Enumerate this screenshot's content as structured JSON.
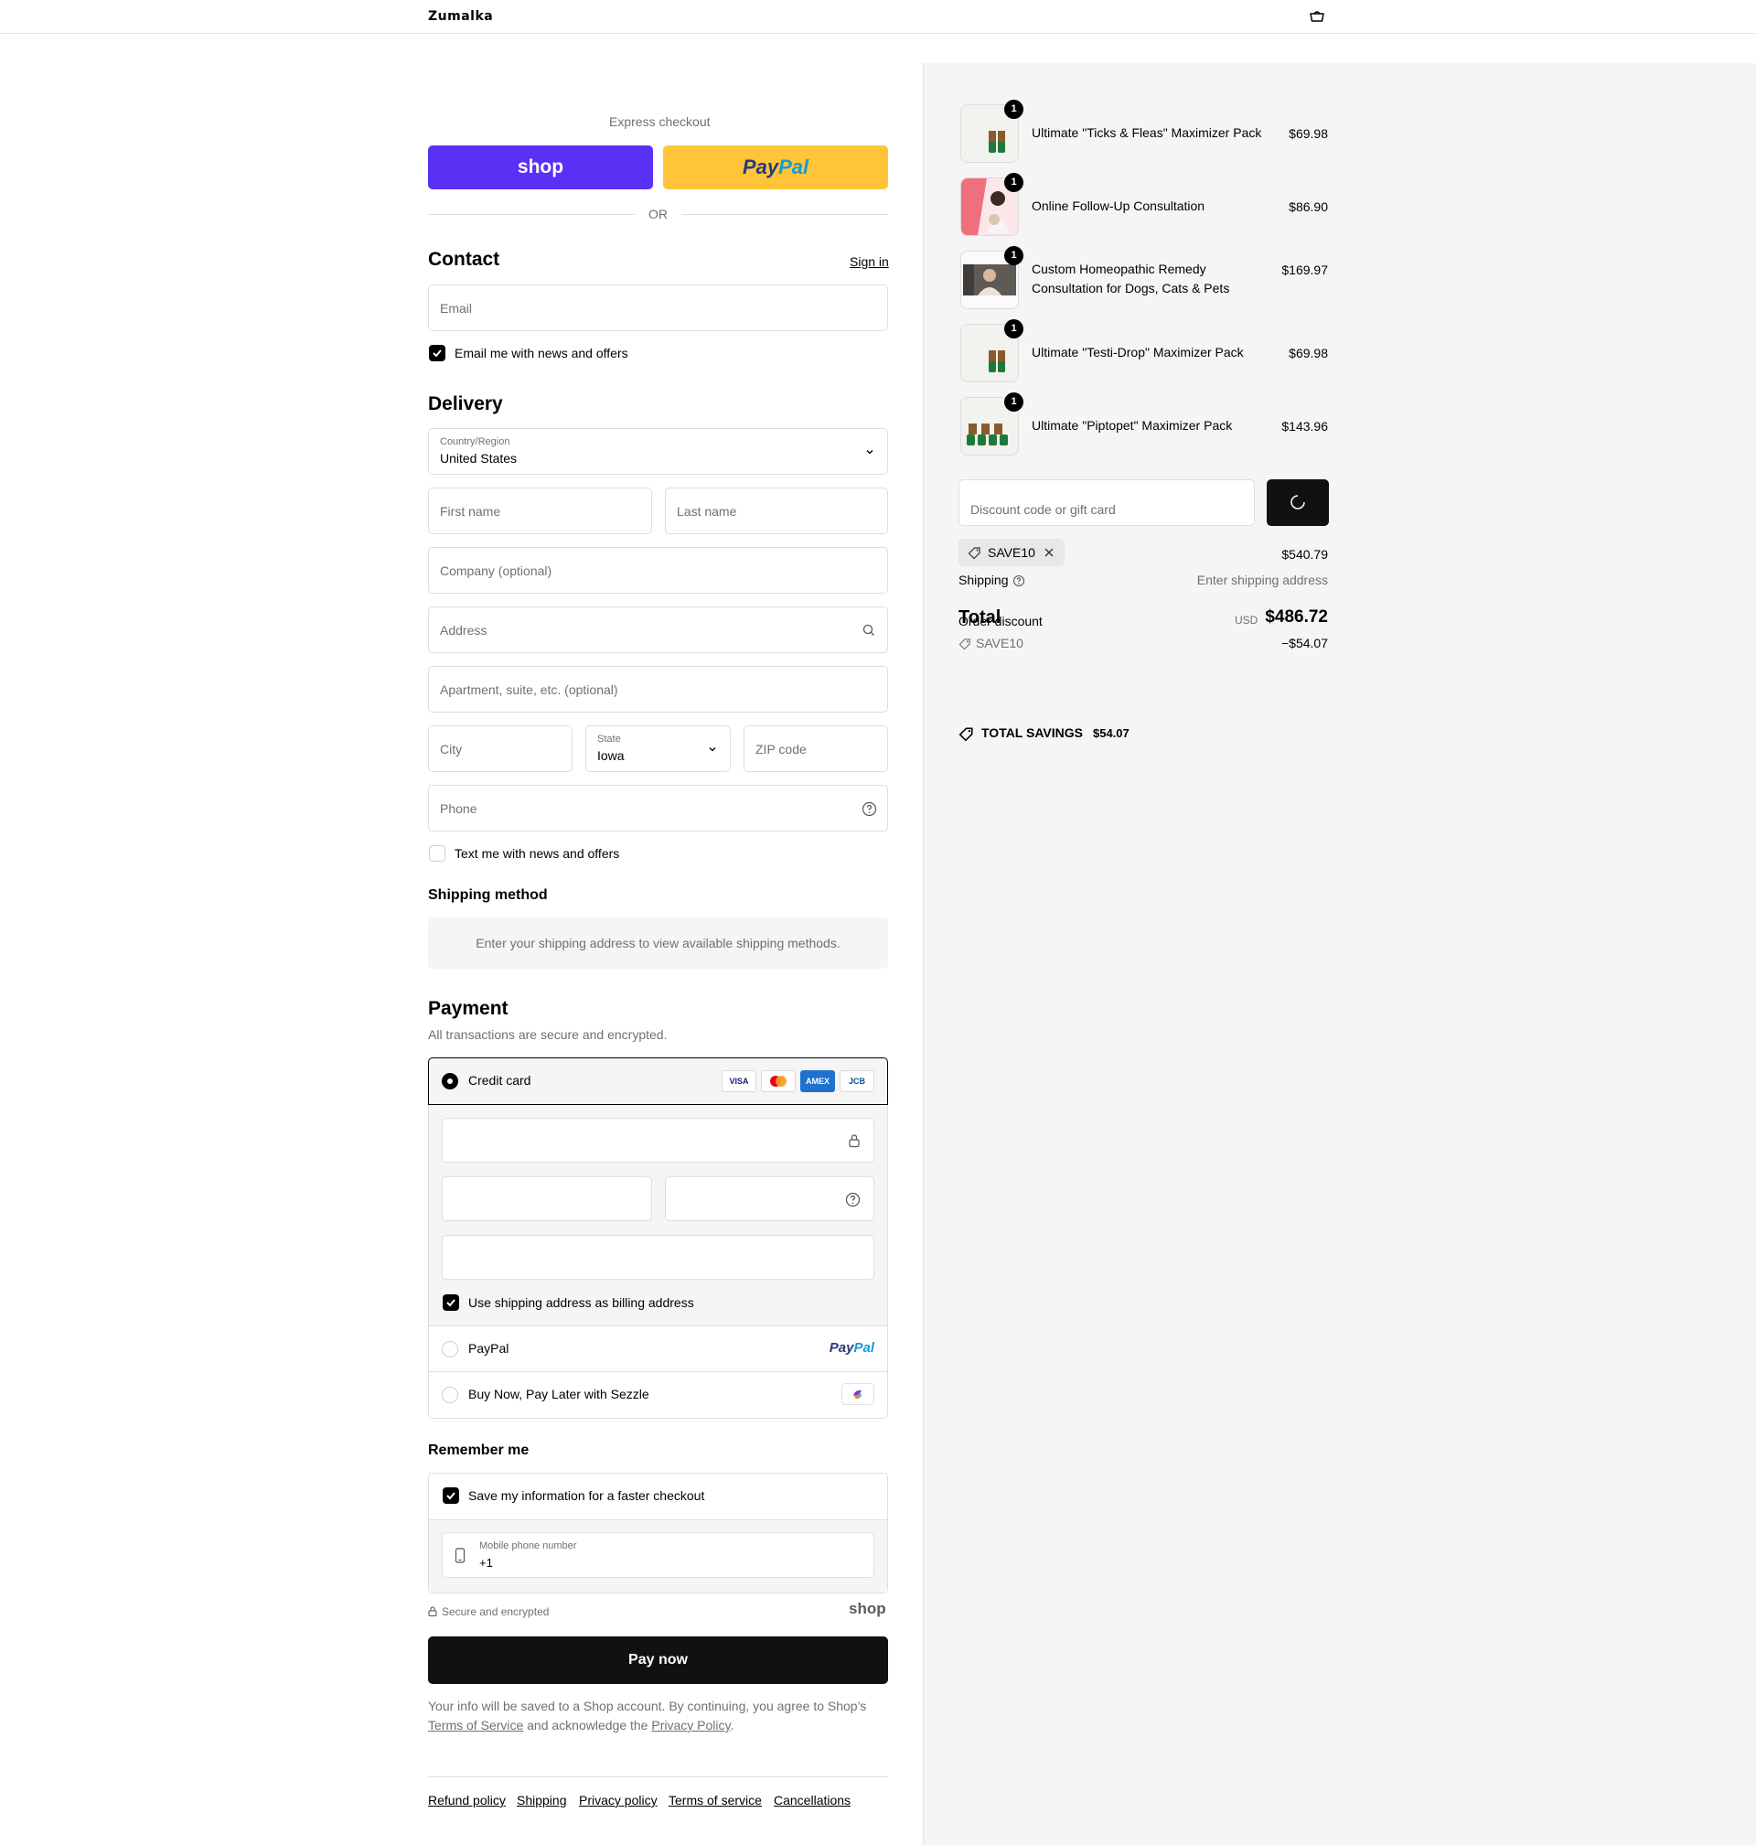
{
  "header": {
    "brand": "Zumalka",
    "cart_icon": "cart-icon"
  },
  "express": {
    "title": "Express checkout",
    "shop_label": "shop",
    "paypal_label_1": "Pay",
    "paypal_label_2": "Pal",
    "or": "OR"
  },
  "contact": {
    "title": "Contact",
    "sign_in": "Sign in",
    "email_placeholder": "Email",
    "news_label": "Email me with news and offers",
    "news_checked": true
  },
  "delivery": {
    "title": "Delivery",
    "country_label": "Country/Region",
    "country_value": "United States",
    "first_name": "First name",
    "last_name": "Last name",
    "company": "Company (optional)",
    "address": "Address",
    "apartment": "Apartment, suite, etc. (optional)",
    "city": "City",
    "state_label": "State",
    "state_value": "Iowa",
    "zip": "ZIP code",
    "phone": "Phone",
    "text_label": "Text me with news and offers",
    "text_checked": false
  },
  "shipping_method": {
    "title": "Shipping method",
    "message": "Enter your shipping address to view available shipping methods."
  },
  "payment": {
    "title": "Payment",
    "subtitle": "All transactions are secure and encrypted.",
    "credit_card_label": "Credit card",
    "brands": [
      "VISA",
      "MC",
      "AMEX",
      "JCB"
    ],
    "billing_label": "Use shipping address as billing address",
    "billing_checked": true,
    "paypal_label": "PayPal",
    "paypal_logo_1": "Pay",
    "paypal_logo_2": "Pal",
    "sezzle_label": "Buy Now, Pay Later with Sezzle"
  },
  "remember": {
    "title": "Remember me",
    "save_label": "Save my information for a faster checkout",
    "save_checked": true,
    "phone_label": "Mobile phone number",
    "phone_value": "+1",
    "secure": "Secure and encrypted",
    "shop": "shop"
  },
  "pay_now": "Pay now",
  "legal": {
    "text1": "Your info will be saved to a Shop account. By continuing, you agree to Shop’s",
    "terms": "Terms of Service",
    "text2": "and acknowledge the",
    "privacy": "Privacy Policy",
    "end": "."
  },
  "footer": [
    "Refund policy",
    "Shipping",
    "Privacy policy",
    "Terms of service",
    "Cancellations"
  ],
  "summary": {
    "items": [
      {
        "name": "Ultimate \"Ticks & Fleas\" Maximizer Pack",
        "price": "$69.98",
        "qty": "1"
      },
      {
        "name": "Online Follow-Up Consultation",
        "price": "$86.90",
        "qty": "1"
      },
      {
        "name": "Custom Homeopathic Remedy Consultation for Dogs, Cats & Pets",
        "price": "$169.97",
        "qty": "1"
      },
      {
        "name": "Ultimate \"Testi-Drop\" Maximizer Pack",
        "price": "$69.98",
        "qty": "1"
      },
      {
        "name": "Ultimate \"Piptopet\" Maximizer Pack",
        "price": "$143.96",
        "qty": "1"
      }
    ],
    "discount_placeholder": "Discount code or gift card",
    "code": "SAVE10",
    "subtotal": "$540.79",
    "shipping_label": "Shipping",
    "shipping_value": "Enter shipping address",
    "total_label": "Total",
    "order_discount_label": "Order discount",
    "currency": "USD",
    "total": "$486.72",
    "discount_code": "SAVE10",
    "discount_value": "−$54.07",
    "savings_label": "TOTAL SAVINGS",
    "savings_value": "$54.07"
  }
}
